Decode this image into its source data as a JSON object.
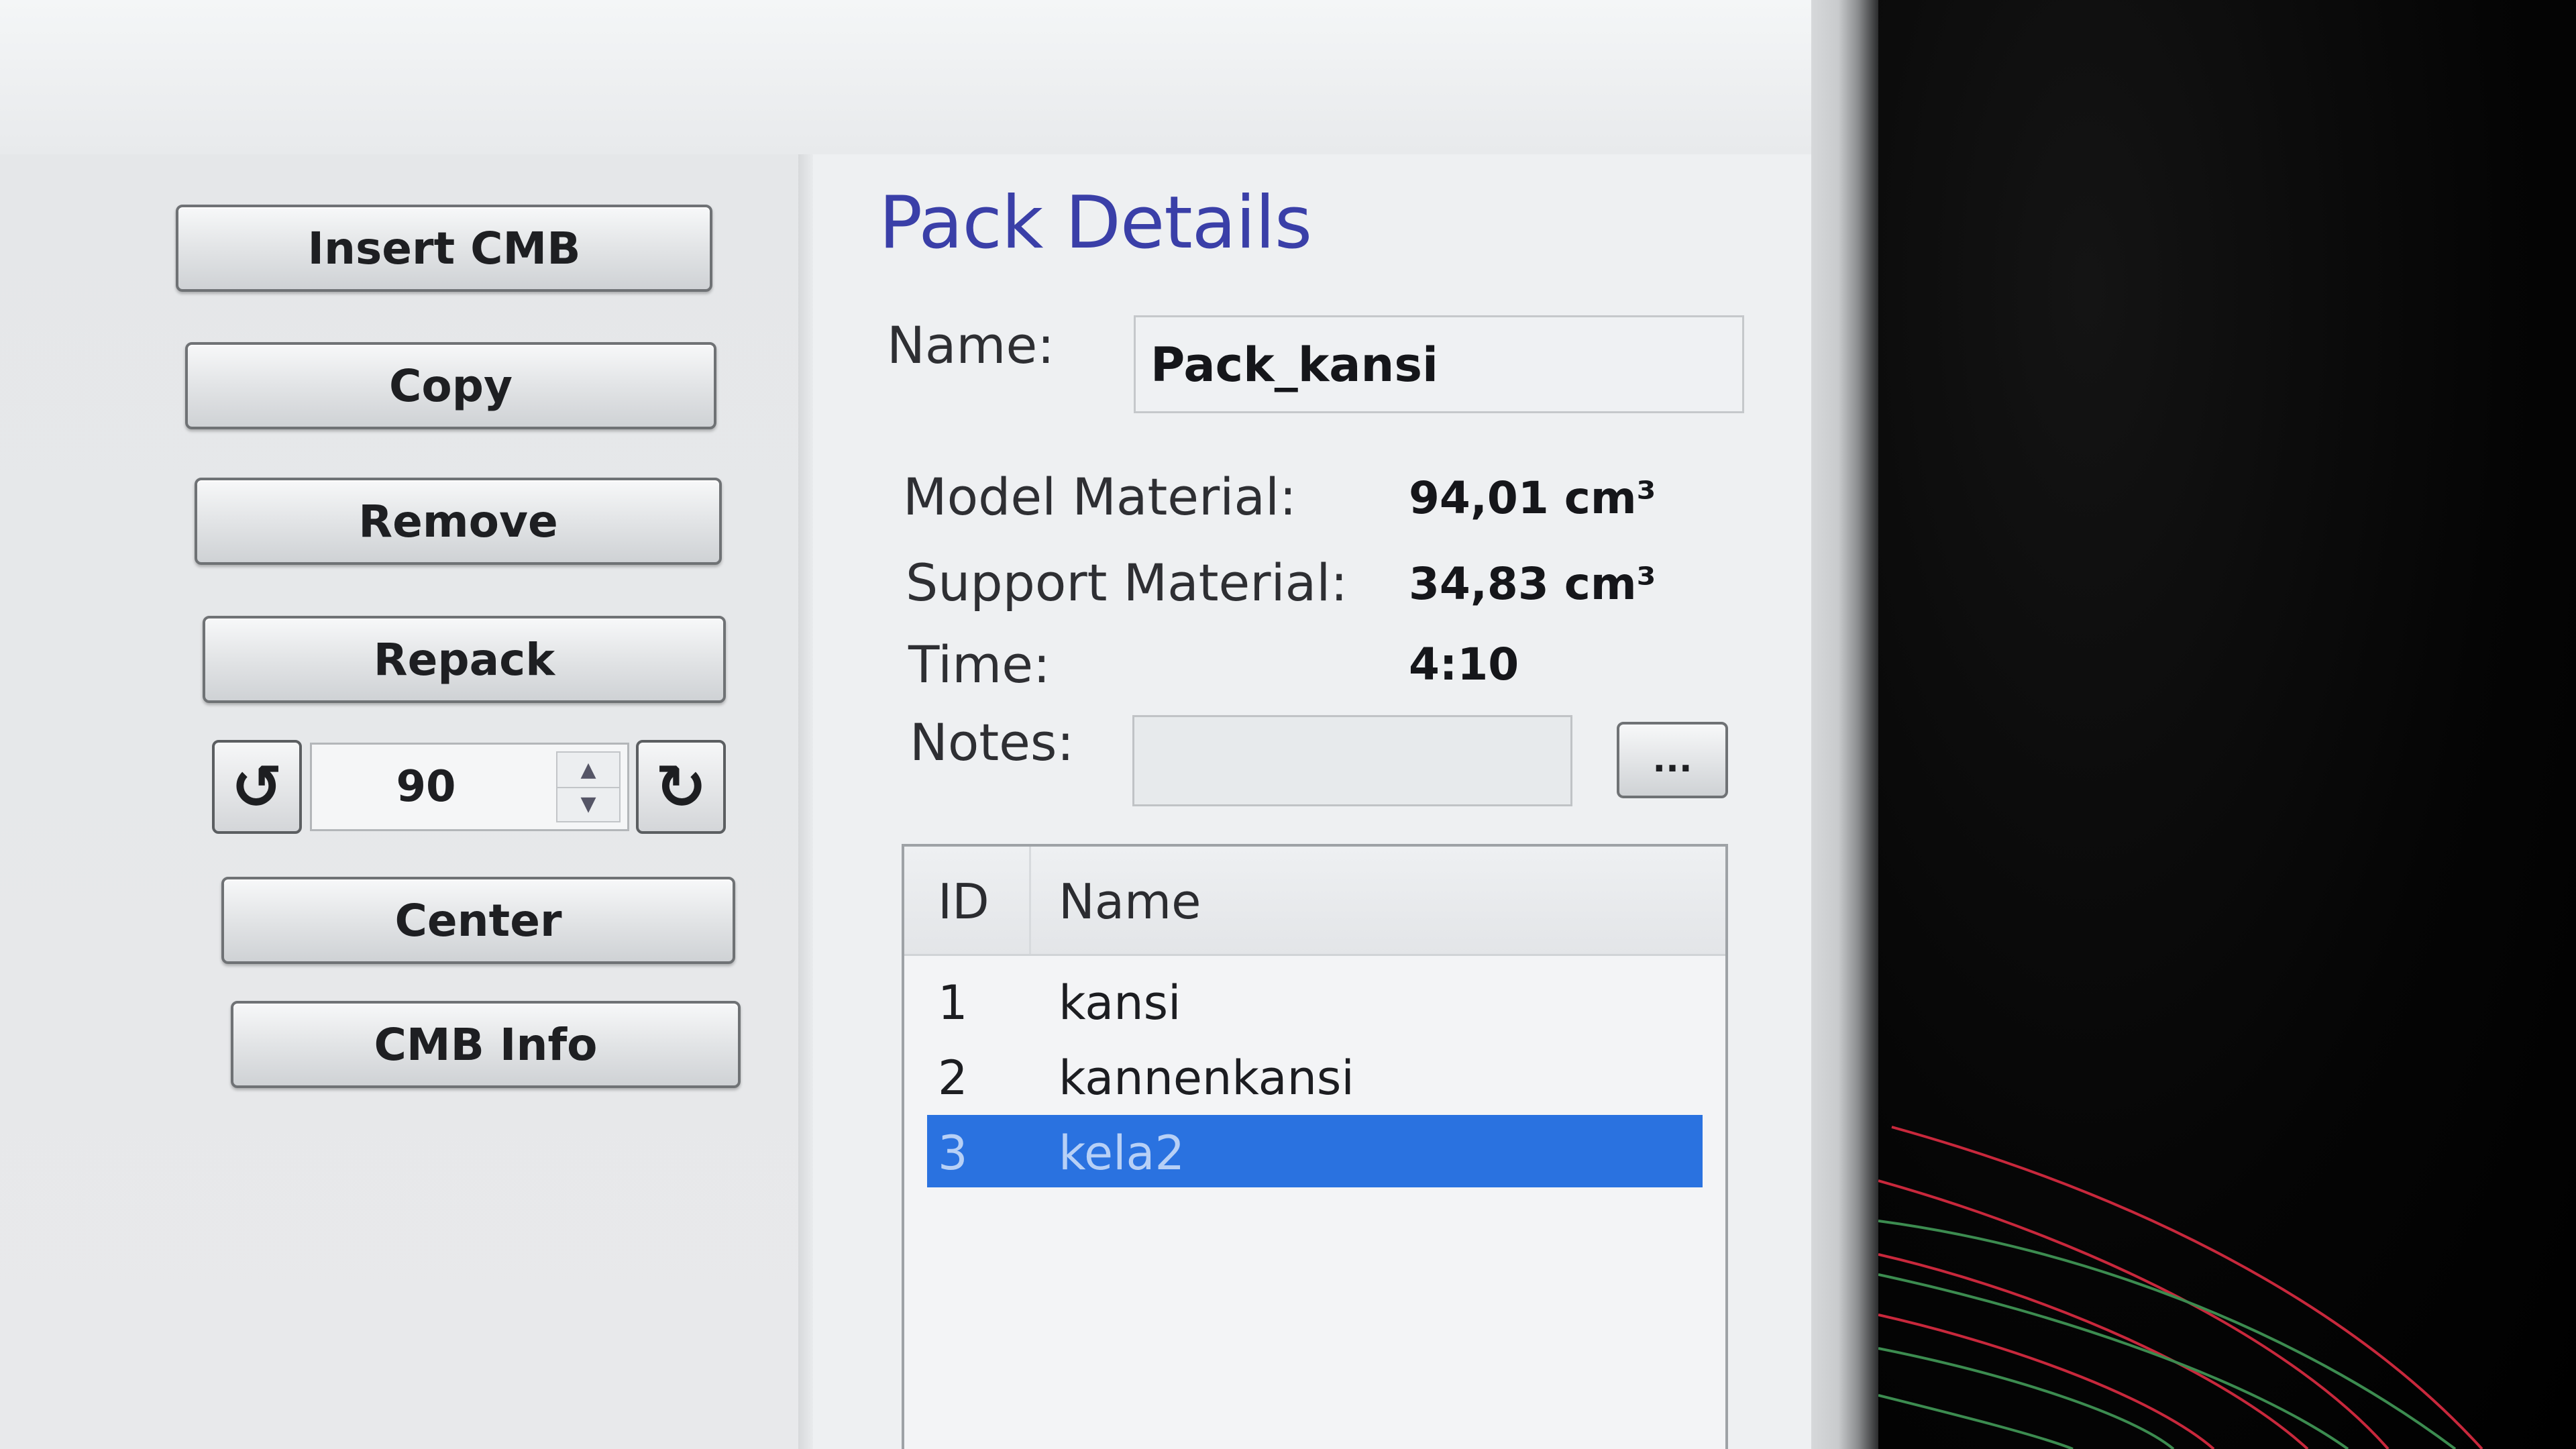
{
  "toolbar": {
    "insert_cmb": "Insert CMB",
    "copy": "Copy",
    "remove": "Remove",
    "repack": "Repack",
    "rotation_value": "90",
    "center": "Center",
    "cmb_info": "CMB Info"
  },
  "pack_details": {
    "title": "Pack Details",
    "name_label": "Name:",
    "name_value": "Pack_kansi",
    "model_material_label": "Model Material:",
    "model_material_value": "94,01 cm³",
    "support_material_label": "Support Material:",
    "support_material_value": "34,83 cm³",
    "time_label": "Time:",
    "time_value": "4:10",
    "notes_label": "Notes:",
    "notes_value": "",
    "notes_button_label": "..."
  },
  "list": {
    "columns": [
      "ID",
      "Name"
    ],
    "rows": [
      {
        "id": "1",
        "name": "kansi"
      },
      {
        "id": "2",
        "name": "kannenkansi"
      },
      {
        "id": "3",
        "name": "kela2",
        "selected": true
      }
    ]
  },
  "icons": {
    "rotate_ccw": "rotate-ccw-icon",
    "rotate_cw": "rotate-cw-icon",
    "spin_up": "spin-up-icon",
    "spin_down": "spin-down-icon"
  },
  "colors": {
    "title": "#3a3fa8",
    "selection": "#2a72e0",
    "viewport_bg": "#000000",
    "curve_red": "#c8283c",
    "curve_green": "#3c8c50"
  }
}
